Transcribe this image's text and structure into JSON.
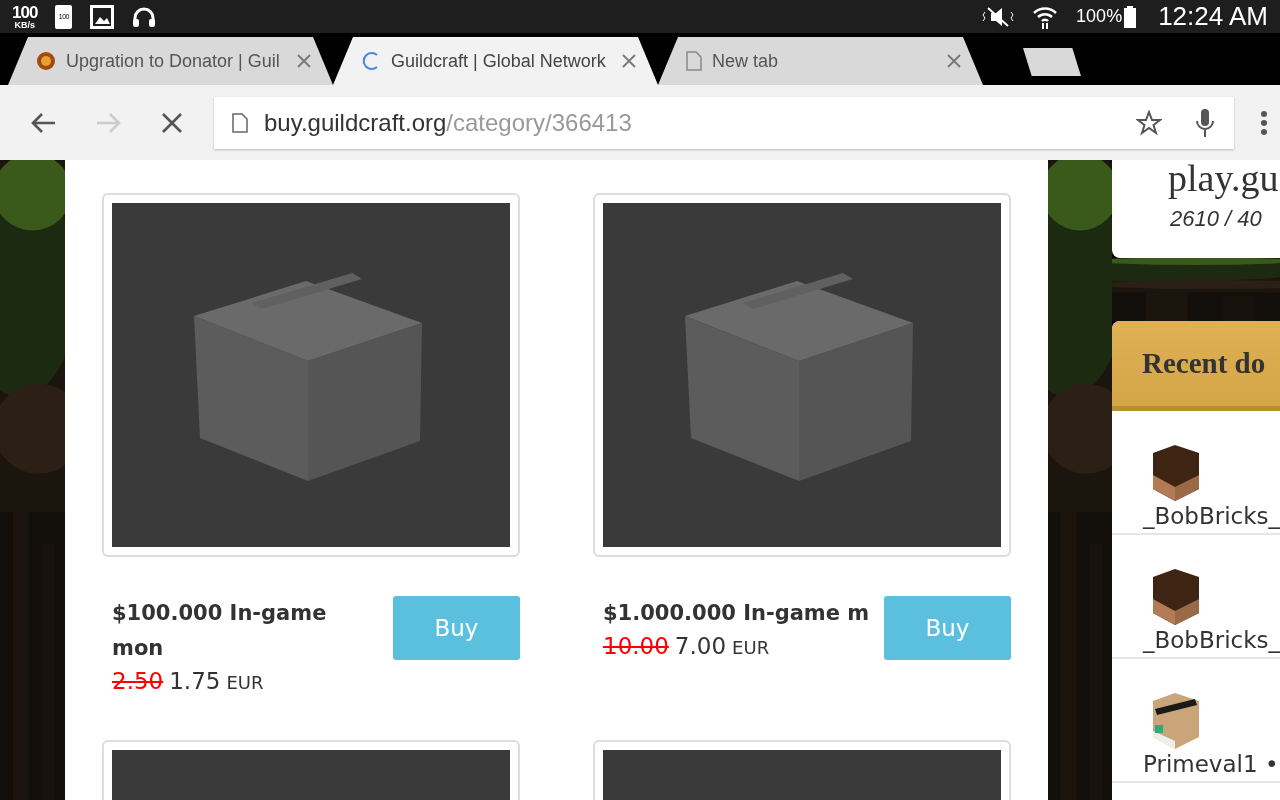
{
  "status_bar": {
    "speed": "100",
    "speed_unit": "KB/s",
    "battery_badge": "100",
    "battery": "100%",
    "time": "12:24 AM"
  },
  "tabs": [
    {
      "title": "Upgration to Donator | Guil",
      "selected": false,
      "kind": "favicon"
    },
    {
      "title": "Guildcraft | Global Network",
      "selected": true,
      "kind": "loading"
    },
    {
      "title": "New tab",
      "selected": false,
      "kind": "page"
    }
  ],
  "toolbar": {
    "url": {
      "host": "buy.guildcraft.org",
      "path": "/category/366413"
    },
    "forward_disabled": true
  },
  "products": [
    {
      "title": "$100.000 In-game mon",
      "old_price": "2.50",
      "price": "1.75",
      "currency": "EUR",
      "button": "Buy"
    },
    {
      "title": "$1.000.000 In-game m",
      "old_price": "10.00",
      "price": "7.00",
      "currency": "EUR",
      "button": "Buy"
    }
  ],
  "server": {
    "address": "play.gu",
    "players": "2610 / 40"
  },
  "recent": {
    "title": "Recent do",
    "donators": [
      {
        "name": "_BobBricks_",
        "kind": "plain"
      },
      {
        "name": "_BobBricks_",
        "kind": "plain"
      },
      {
        "name": "Primeval1 •",
        "kind": "headset"
      }
    ]
  }
}
